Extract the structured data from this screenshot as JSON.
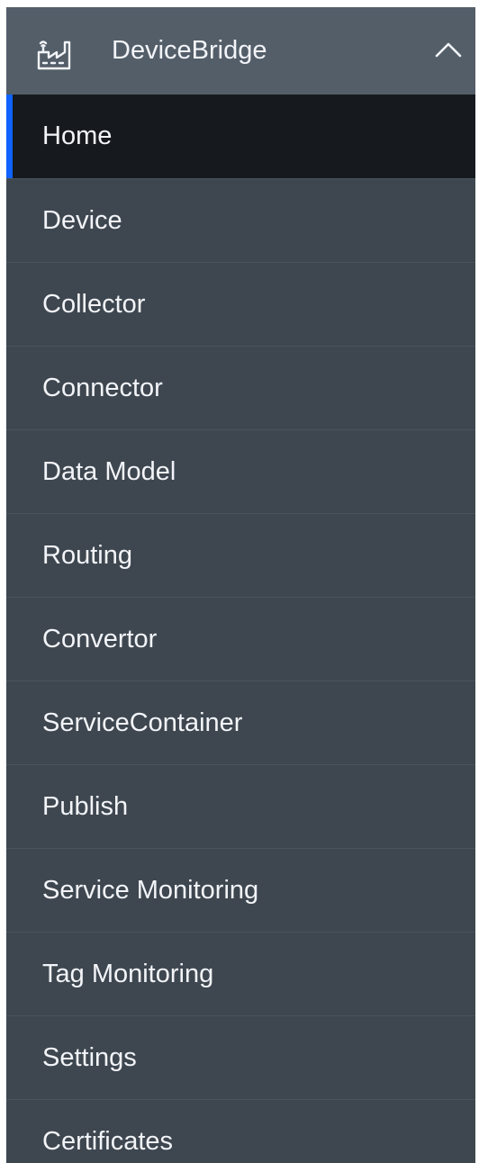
{
  "header": {
    "title": "DeviceBridge",
    "icon": "factory-icon",
    "toggle_icon": "chevron-up-icon"
  },
  "nav": {
    "active_index": 0,
    "items": [
      {
        "label": "Home"
      },
      {
        "label": "Device"
      },
      {
        "label": "Collector"
      },
      {
        "label": "Connector"
      },
      {
        "label": "Data Model"
      },
      {
        "label": "Routing"
      },
      {
        "label": "Convertor"
      },
      {
        "label": "ServiceContainer"
      },
      {
        "label": "Publish"
      },
      {
        "label": "Service Monitoring"
      },
      {
        "label": "Tag Monitoring"
      },
      {
        "label": "Settings"
      },
      {
        "label": "Certificates"
      }
    ]
  },
  "colors": {
    "sidebar_bg": "#3e4750",
    "header_bg": "#535e69",
    "active_bg": "#161a1e",
    "active_indicator": "#0f62fe",
    "text": "#f2f4f8"
  }
}
